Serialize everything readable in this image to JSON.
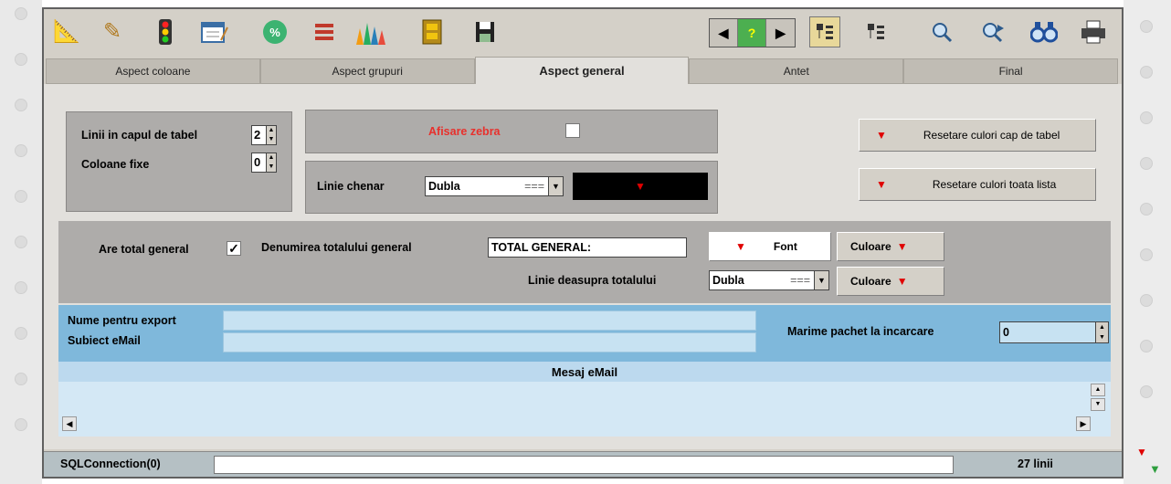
{
  "toolbar": {
    "icons": [
      "edit-ruler-icon",
      "pencil-icon",
      "traffic-light-icon",
      "notepad-icon",
      "percent-icon",
      "list-lines-icon",
      "pencils-icon",
      "cabinet-icon",
      "save-icon"
    ],
    "nav_help_label": "?",
    "right_icons": [
      "prev-icon",
      "help-icon",
      "next-icon",
      "tree-expand-icon",
      "tree-collapse-icon",
      "search-icon",
      "search-next-icon",
      "binoculars-icon",
      "printer-icon"
    ]
  },
  "tabs": [
    {
      "label": "Aspect coloane",
      "active": false
    },
    {
      "label": "Aspect grupuri",
      "active": false
    },
    {
      "label": "Aspect general",
      "active": true
    },
    {
      "label": "Antet",
      "active": false
    },
    {
      "label": "Final",
      "active": false
    }
  ],
  "header_group": {
    "lines_label": "Linii in capul de tabel",
    "lines_value": "2",
    "fixed_cols_label": "Coloane fixe",
    "fixed_cols_value": "0"
  },
  "zebra": {
    "label": "Afisare zebra",
    "checked": false
  },
  "border": {
    "label": "Linie chenar",
    "value": "Dubla",
    "dash": "==="
  },
  "reset_buttons": {
    "header_colors": "Resetare culori cap de tabel",
    "list_colors": "Resetare culori toata lista"
  },
  "totals": {
    "has_total_label": "Are total general",
    "has_total_checked": true,
    "name_label": "Denumirea totalului general",
    "name_value": "TOTAL GENERAL:",
    "font_button": "Font",
    "color_button_1": "Culoare",
    "line_above_label": "Linie deasupra totalului",
    "line_above_value": "Dubla",
    "line_above_dash": "===",
    "color_button_2": "Culoare"
  },
  "export": {
    "name_label": "Nume pentru export",
    "subject_label": "Subiect eMail",
    "packet_label": "Marime pachet la incarcare",
    "packet_value": "0",
    "message_label": "Mesaj eMail"
  },
  "status": {
    "connection": "SQLConnection(0)",
    "lines": "27 linii"
  },
  "colors": {
    "accent_red": "#e00000",
    "blue_area": "#7fb8db",
    "zebra_label": "#e8302c"
  }
}
